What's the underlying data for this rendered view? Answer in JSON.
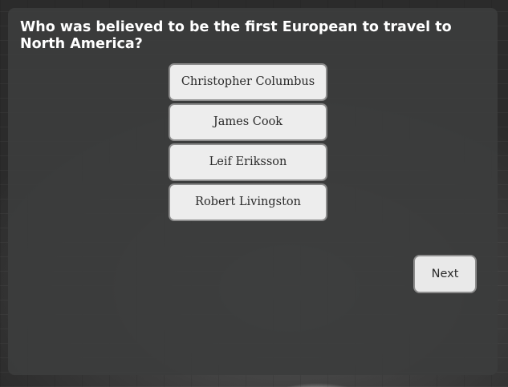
{
  "quiz": {
    "question": "Who was believed to be the first European to travel to North America?",
    "answers": [
      {
        "label": "Christopher Columbus"
      },
      {
        "label": "James Cook"
      },
      {
        "label": "Leif Eriksson"
      },
      {
        "label": "Robert Livingston"
      }
    ],
    "next_label": "Next"
  }
}
